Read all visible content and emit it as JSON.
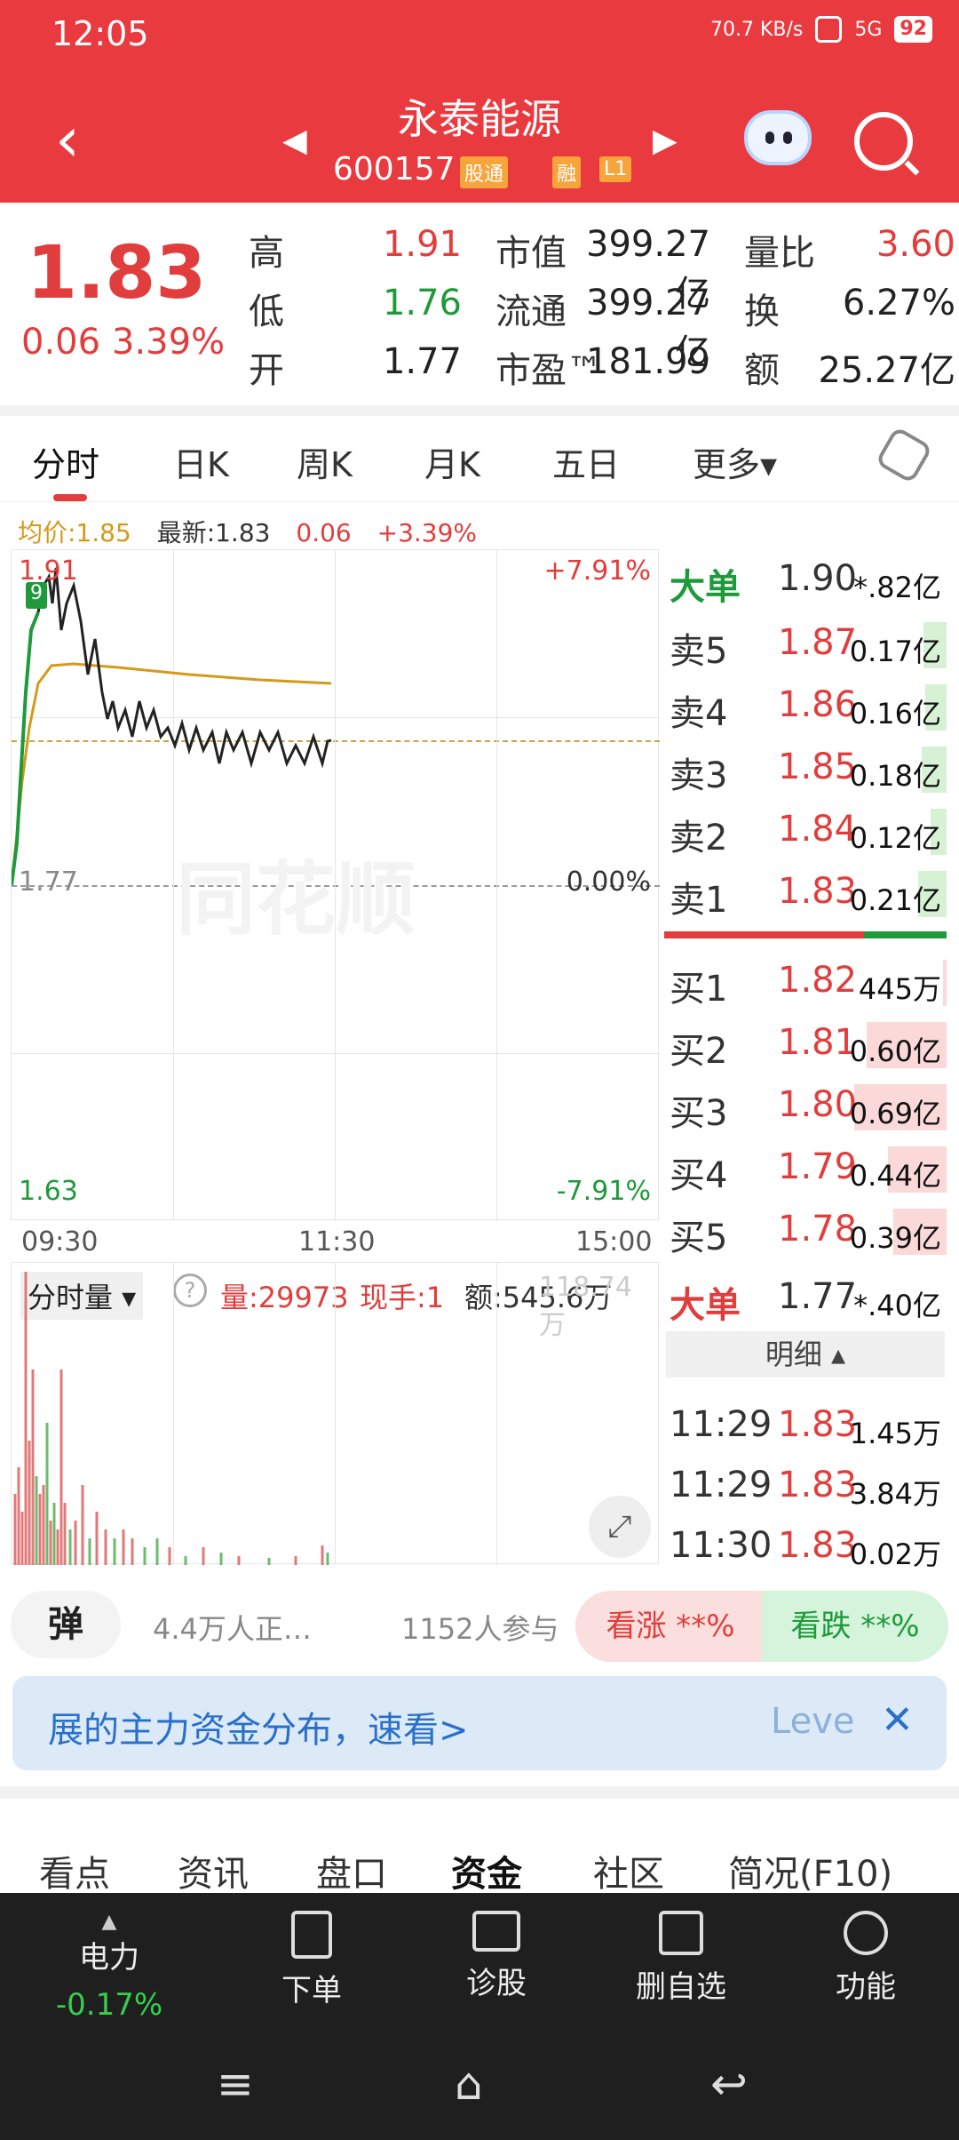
{
  "status_bar": {
    "time": "12:05",
    "net_speed": "70.7 KB/s",
    "battery": "92",
    "signal": "5G"
  },
  "header": {
    "name": "永泰能源",
    "code": "600157",
    "tags": [
      "股通",
      "融",
      "L1"
    ]
  },
  "quote": {
    "price": "1.83",
    "change": "0.06",
    "change_pct": "3.39%",
    "rows": [
      {
        "l1": "高",
        "v1": "1.91",
        "l2": "市值",
        "v2": "399.27亿",
        "l3": "量比",
        "v3": "3.60"
      },
      {
        "l1": "低",
        "v1": "1.76",
        "l2": "流通",
        "v2": "399.27亿",
        "l3": "换",
        "v3": "6.27%"
      },
      {
        "l1": "开",
        "v1": "1.77",
        "l2": "市盈™",
        "v2": "181.99",
        "l3": "额",
        "v3": "25.27亿"
      }
    ]
  },
  "tabs": [
    "分时",
    "日K",
    "周K",
    "月K",
    "五日",
    "更多▾"
  ],
  "avg_line": {
    "avg": "均价:1.85",
    "latest_label": "最新:1.83",
    "chg": "0.06",
    "pct": "+3.39%"
  },
  "chart": {
    "y_top": "1.91",
    "y_mid": "1.77",
    "y_bot": "1.63",
    "pct_top": "+7.91%",
    "pct_mid": "0.00%",
    "pct_bot": "-7.91%",
    "x_labels": [
      "09:30",
      "11:30",
      "15:00"
    ],
    "marker": "9",
    "watermark": "同花顺"
  },
  "volume": {
    "selector": "分时量 ▾",
    "help": "?",
    "qty": "量:29973",
    "hand": "现手:1",
    "amount": "额:545.6万",
    "ghost": "118.74万"
  },
  "orderbook": {
    "big_sell": {
      "label": "大单",
      "price": "1.90",
      "vol": "*.82亿"
    },
    "asks": [
      {
        "label": "卖5",
        "price": "1.87",
        "vol": "0.17亿"
      },
      {
        "label": "卖4",
        "price": "1.86",
        "vol": "0.16亿"
      },
      {
        "label": "卖3",
        "price": "1.85",
        "vol": "0.18亿"
      },
      {
        "label": "卖2",
        "price": "1.84",
        "vol": "0.12亿"
      },
      {
        "label": "卖1",
        "price": "1.83",
        "vol": "0.21亿"
      }
    ],
    "bids": [
      {
        "label": "买1",
        "price": "1.82",
        "vol": "445万"
      },
      {
        "label": "买2",
        "price": "1.81",
        "vol": "0.60亿"
      },
      {
        "label": "买3",
        "price": "1.80",
        "vol": "0.69亿"
      },
      {
        "label": "买4",
        "price": "1.79",
        "vol": "0.44亿"
      },
      {
        "label": "买5",
        "price": "1.78",
        "vol": "0.39亿"
      }
    ],
    "big_buy": {
      "label": "大单",
      "price": "1.77",
      "vol": "*.40亿"
    },
    "detail_label": "明细 ▴",
    "ticks": [
      {
        "time": "11:29",
        "price": "1.83",
        "vol": "1.45万"
      },
      {
        "time": "11:29",
        "price": "1.83",
        "vol": "3.84万"
      },
      {
        "time": "11:30",
        "price": "1.83",
        "vol": "0.02万"
      }
    ]
  },
  "promo": {
    "danmu": "弹",
    "watching": "4.4万人正…",
    "participants": "1152人参与",
    "up": "看涨 **%",
    "down": "看跌 **%"
  },
  "banner": {
    "text": "展的主力资金分布，速看>",
    "right": "Leve",
    "close": "✕"
  },
  "bottom_tabs": [
    "看点",
    "资讯",
    "盘口",
    "资金",
    "社区",
    "简况(F10)"
  ],
  "bottom_nav": {
    "sector": {
      "name": "电力",
      "pct": "-0.17%"
    },
    "items": [
      "下单",
      "诊股",
      "删自选",
      "功能"
    ]
  },
  "sys_nav": {
    "menu": "≡",
    "home": "⌂",
    "back": "↩"
  }
}
